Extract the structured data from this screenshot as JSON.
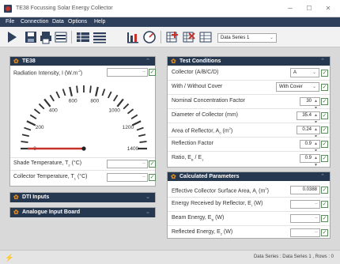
{
  "window": {
    "title": "TE38 Focussing Solar Energy Collector",
    "minimize": "–",
    "maximize": "☐",
    "close": "✕"
  },
  "menu": [
    "File",
    "Connection",
    "Data",
    "Options",
    "Help"
  ],
  "toolbar": {
    "series_select": "Data Series 1",
    "dropdown_glyph": "⌄"
  },
  "panel_te38": {
    "title": "TE38",
    "radiation_label": "Radiation Intensity, I  (W.m",
    "radiation_label_sup": "-2",
    "radiation_label_end": ")",
    "radiation_value": "--",
    "gauge": {
      "min": 0,
      "max": 1400,
      "value": 0,
      "ticks": [
        "0",
        "200",
        "400",
        "600",
        "800",
        "1000",
        "1200",
        "1400"
      ]
    },
    "shade_temp_label": "Shade Temperature, T",
    "shade_temp_sub": "2",
    "shade_temp_unit": " (°C)",
    "shade_temp_value": "--",
    "collector_temp_label": "Collector Temperature, T",
    "collector_temp_sub": "1",
    "collector_temp_unit": " (°C)",
    "collector_temp_value": "--"
  },
  "panel_dti": {
    "title": "DTI Inputs"
  },
  "panel_analogue": {
    "title": "Analogue Input Board"
  },
  "test_conditions": {
    "title": "Test Conditions",
    "rows": [
      {
        "label": "Collector (A/B/C/D)",
        "value": "A",
        "kind": "select"
      },
      {
        "label": "With / Without Cover",
        "value": "With Cover",
        "kind": "select"
      },
      {
        "label": "Nominal Concentration Factor",
        "value": "30",
        "kind": "spin"
      },
      {
        "label": "Diameter of Collector (mm)",
        "value": "35.4",
        "kind": "spin"
      },
      {
        "label": "Area of Reflector, A",
        "sub": "0",
        "suffix": " (m",
        "sup": "2",
        "end": ")",
        "value": "0.24",
        "kind": "spin"
      },
      {
        "label": "Reflection Factor",
        "value": "0.9",
        "kind": "spin"
      },
      {
        "label": "Ratio, E",
        "sub": "B",
        "suffix": " / E",
        "sub2": "1",
        "value": "0.9",
        "kind": "spin"
      }
    ]
  },
  "calculated": {
    "title": "Calculated Parameters",
    "rows": [
      {
        "label": "Effective Collector Surface Area, A",
        "sub": "r",
        "suffix": "  (m",
        "sup": "2",
        "end": ")",
        "value": "0.0388"
      },
      {
        "label": "Energy Received by Reflector, E",
        "sub": "r",
        "suffix": "  (W)",
        "value": "--"
      },
      {
        "label": "Beam Energy, E",
        "sub": "B",
        "suffix": "  (W)",
        "value": "--"
      },
      {
        "label": "Reflected Energy, E",
        "sub": "2",
        "suffix": "  (W)",
        "value": "--"
      }
    ]
  },
  "status": {
    "text": "Data Series : Data Series 1 ,  Rows : 0"
  },
  "colors": {
    "menu": "#2f405c",
    "panel_header": "#263750",
    "accent_red": "#c7322d",
    "gear": "#e08a1e"
  }
}
